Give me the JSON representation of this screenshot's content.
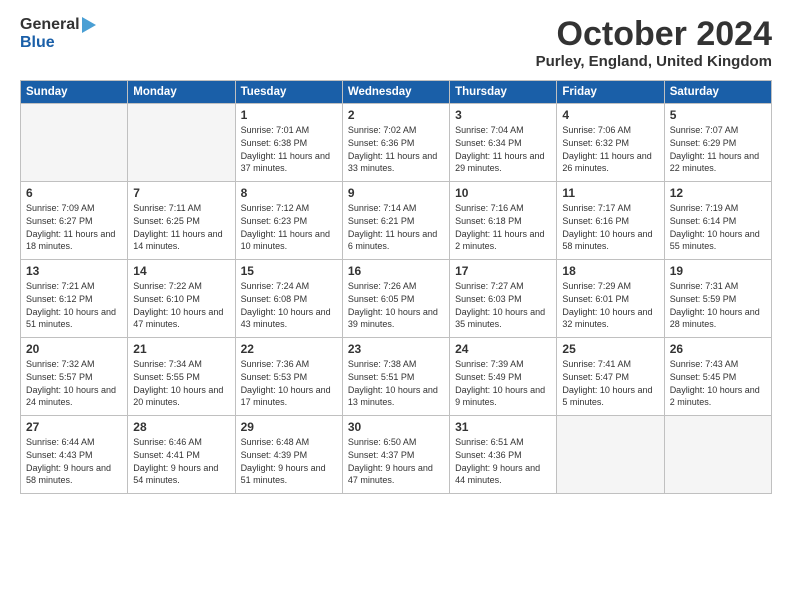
{
  "header": {
    "logo_general": "General",
    "logo_blue": "Blue",
    "month": "October 2024",
    "location": "Purley, England, United Kingdom"
  },
  "days_of_week": [
    "Sunday",
    "Monday",
    "Tuesday",
    "Wednesday",
    "Thursday",
    "Friday",
    "Saturday"
  ],
  "weeks": [
    [
      {
        "day": "",
        "info": ""
      },
      {
        "day": "",
        "info": ""
      },
      {
        "day": "1",
        "info": "Sunrise: 7:01 AM\nSunset: 6:38 PM\nDaylight: 11 hours and 37 minutes."
      },
      {
        "day": "2",
        "info": "Sunrise: 7:02 AM\nSunset: 6:36 PM\nDaylight: 11 hours and 33 minutes."
      },
      {
        "day": "3",
        "info": "Sunrise: 7:04 AM\nSunset: 6:34 PM\nDaylight: 11 hours and 29 minutes."
      },
      {
        "day": "4",
        "info": "Sunrise: 7:06 AM\nSunset: 6:32 PM\nDaylight: 11 hours and 26 minutes."
      },
      {
        "day": "5",
        "info": "Sunrise: 7:07 AM\nSunset: 6:29 PM\nDaylight: 11 hours and 22 minutes."
      }
    ],
    [
      {
        "day": "6",
        "info": "Sunrise: 7:09 AM\nSunset: 6:27 PM\nDaylight: 11 hours and 18 minutes."
      },
      {
        "day": "7",
        "info": "Sunrise: 7:11 AM\nSunset: 6:25 PM\nDaylight: 11 hours and 14 minutes."
      },
      {
        "day": "8",
        "info": "Sunrise: 7:12 AM\nSunset: 6:23 PM\nDaylight: 11 hours and 10 minutes."
      },
      {
        "day": "9",
        "info": "Sunrise: 7:14 AM\nSunset: 6:21 PM\nDaylight: 11 hours and 6 minutes."
      },
      {
        "day": "10",
        "info": "Sunrise: 7:16 AM\nSunset: 6:18 PM\nDaylight: 11 hours and 2 minutes."
      },
      {
        "day": "11",
        "info": "Sunrise: 7:17 AM\nSunset: 6:16 PM\nDaylight: 10 hours and 58 minutes."
      },
      {
        "day": "12",
        "info": "Sunrise: 7:19 AM\nSunset: 6:14 PM\nDaylight: 10 hours and 55 minutes."
      }
    ],
    [
      {
        "day": "13",
        "info": "Sunrise: 7:21 AM\nSunset: 6:12 PM\nDaylight: 10 hours and 51 minutes."
      },
      {
        "day": "14",
        "info": "Sunrise: 7:22 AM\nSunset: 6:10 PM\nDaylight: 10 hours and 47 minutes."
      },
      {
        "day": "15",
        "info": "Sunrise: 7:24 AM\nSunset: 6:08 PM\nDaylight: 10 hours and 43 minutes."
      },
      {
        "day": "16",
        "info": "Sunrise: 7:26 AM\nSunset: 6:05 PM\nDaylight: 10 hours and 39 minutes."
      },
      {
        "day": "17",
        "info": "Sunrise: 7:27 AM\nSunset: 6:03 PM\nDaylight: 10 hours and 35 minutes."
      },
      {
        "day": "18",
        "info": "Sunrise: 7:29 AM\nSunset: 6:01 PM\nDaylight: 10 hours and 32 minutes."
      },
      {
        "day": "19",
        "info": "Sunrise: 7:31 AM\nSunset: 5:59 PM\nDaylight: 10 hours and 28 minutes."
      }
    ],
    [
      {
        "day": "20",
        "info": "Sunrise: 7:32 AM\nSunset: 5:57 PM\nDaylight: 10 hours and 24 minutes."
      },
      {
        "day": "21",
        "info": "Sunrise: 7:34 AM\nSunset: 5:55 PM\nDaylight: 10 hours and 20 minutes."
      },
      {
        "day": "22",
        "info": "Sunrise: 7:36 AM\nSunset: 5:53 PM\nDaylight: 10 hours and 17 minutes."
      },
      {
        "day": "23",
        "info": "Sunrise: 7:38 AM\nSunset: 5:51 PM\nDaylight: 10 hours and 13 minutes."
      },
      {
        "day": "24",
        "info": "Sunrise: 7:39 AM\nSunset: 5:49 PM\nDaylight: 10 hours and 9 minutes."
      },
      {
        "day": "25",
        "info": "Sunrise: 7:41 AM\nSunset: 5:47 PM\nDaylight: 10 hours and 5 minutes."
      },
      {
        "day": "26",
        "info": "Sunrise: 7:43 AM\nSunset: 5:45 PM\nDaylight: 10 hours and 2 minutes."
      }
    ],
    [
      {
        "day": "27",
        "info": "Sunrise: 6:44 AM\nSunset: 4:43 PM\nDaylight: 9 hours and 58 minutes."
      },
      {
        "day": "28",
        "info": "Sunrise: 6:46 AM\nSunset: 4:41 PM\nDaylight: 9 hours and 54 minutes."
      },
      {
        "day": "29",
        "info": "Sunrise: 6:48 AM\nSunset: 4:39 PM\nDaylight: 9 hours and 51 minutes."
      },
      {
        "day": "30",
        "info": "Sunrise: 6:50 AM\nSunset: 4:37 PM\nDaylight: 9 hours and 47 minutes."
      },
      {
        "day": "31",
        "info": "Sunrise: 6:51 AM\nSunset: 4:36 PM\nDaylight: 9 hours and 44 minutes."
      },
      {
        "day": "",
        "info": ""
      },
      {
        "day": "",
        "info": ""
      }
    ]
  ]
}
